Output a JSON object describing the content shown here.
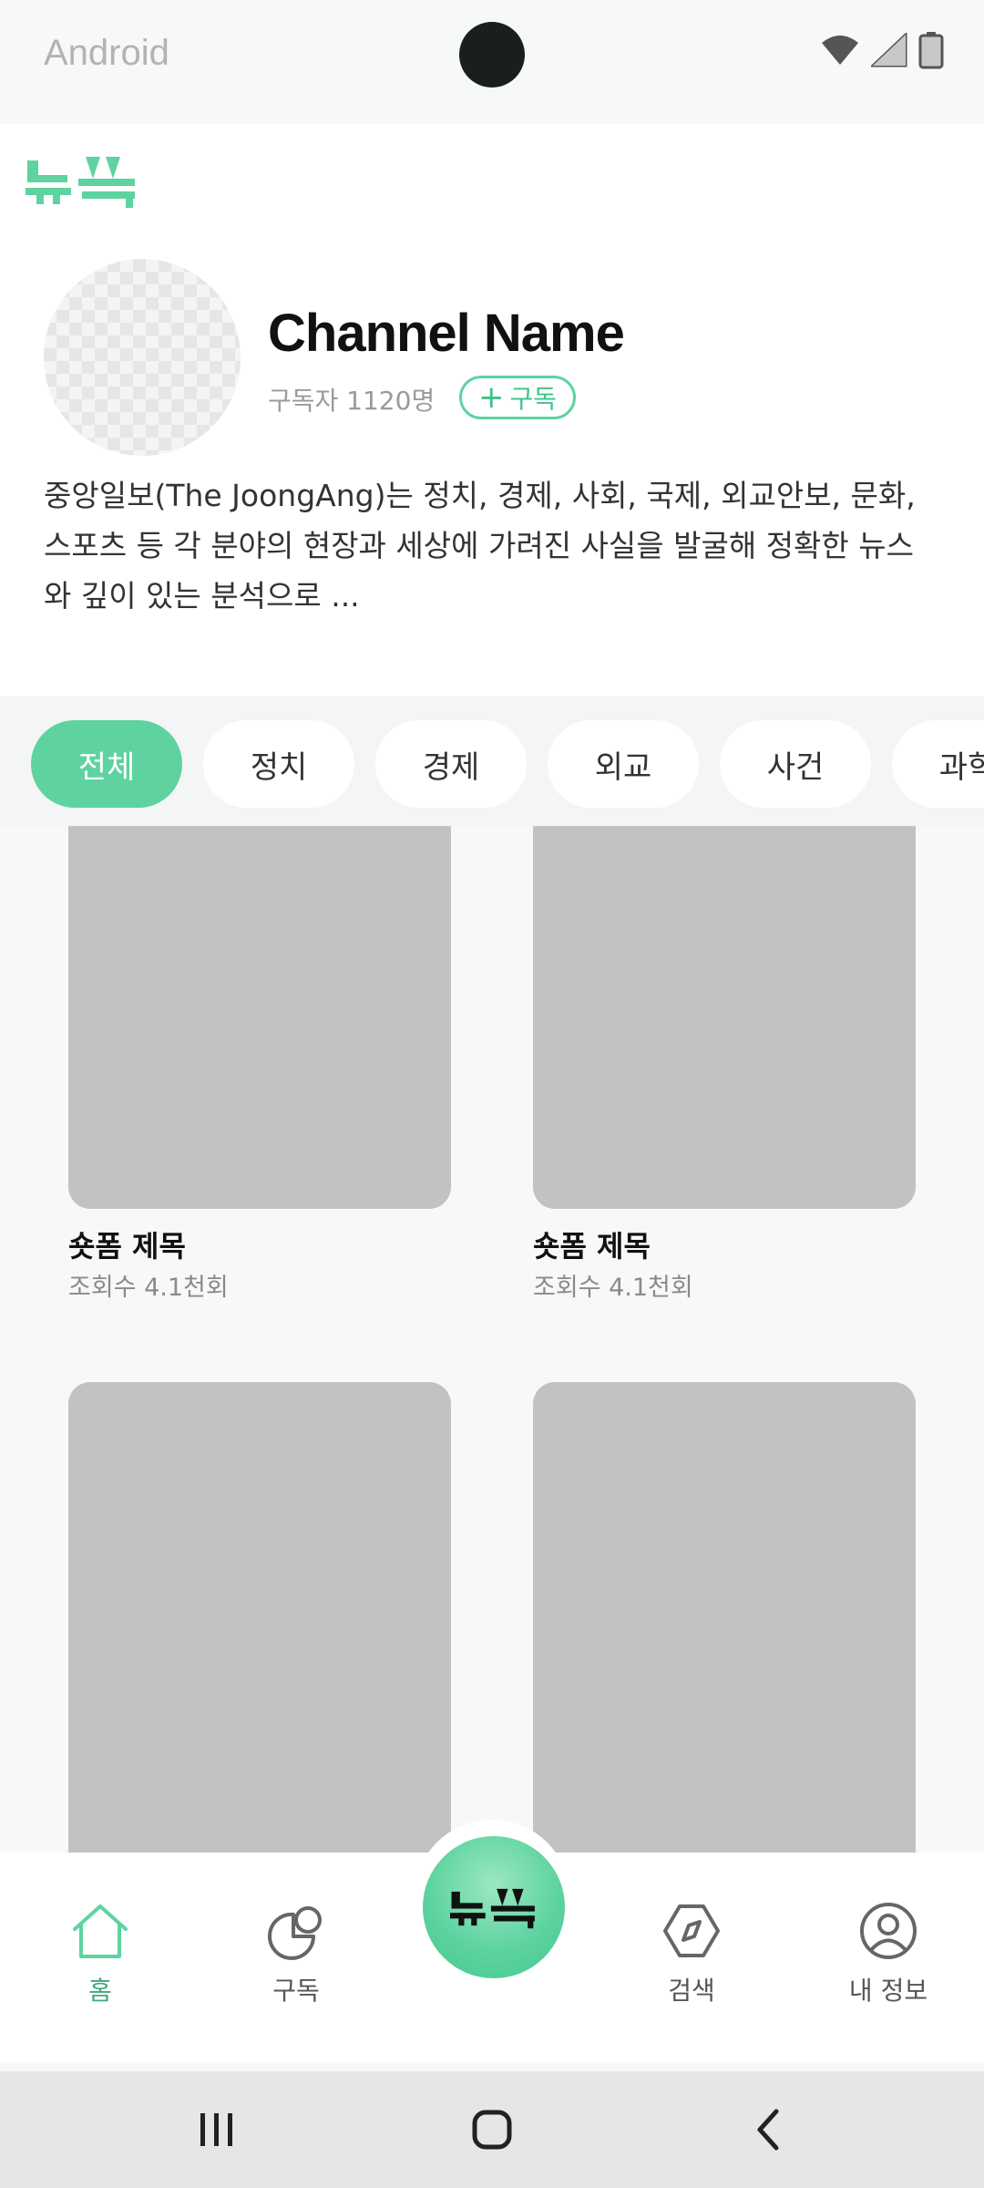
{
  "status_bar": {
    "carrier": "Android"
  },
  "app": {
    "brand_color": "#5ed3a0"
  },
  "channel": {
    "name": "Channel Name",
    "subscribers": "구독자 1120명",
    "subscribe_label": "구독",
    "description": "중앙일보(The JoongAng)는 정치, 경제, 사회, 국제, 외교안보, 문화, 스포츠 등 각 분야의 현장과 세상에 가려진 사실을 발굴해 정확한 뉴스와 깊이 있는 분석으로 ..."
  },
  "tabs": [
    {
      "label": "전체",
      "active": true
    },
    {
      "label": "정치",
      "active": false
    },
    {
      "label": "경제",
      "active": false
    },
    {
      "label": "외교",
      "active": false
    },
    {
      "label": "사건",
      "active": false
    },
    {
      "label": "과학",
      "active": false
    }
  ],
  "shorts": [
    {
      "title": "숏폼 제목",
      "views": "조회수 4.1천회"
    },
    {
      "title": "숏폼 제목",
      "views": "조회수 4.1천회"
    },
    {
      "title": "",
      "views": ""
    },
    {
      "title": "",
      "views": ""
    }
  ],
  "bottom_nav": {
    "home": "홈",
    "subscriptions": "구독",
    "search": "검색",
    "my_info": "내 정보",
    "active": "home"
  }
}
